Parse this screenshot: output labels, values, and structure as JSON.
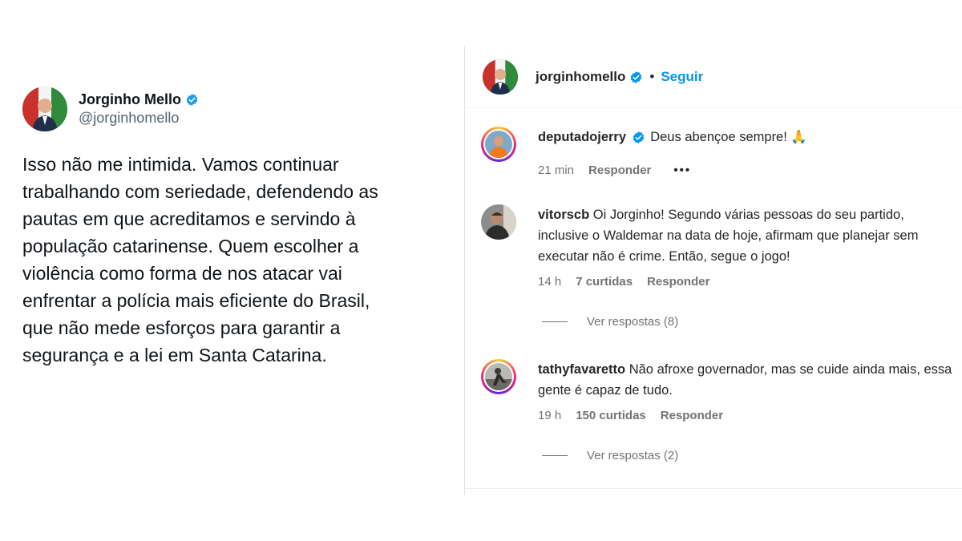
{
  "tweet": {
    "name": "Jorginho Mello",
    "handle": "@jorginhomello",
    "text": "Isso não me intimida. Vamos continuar\ntrabalhando com seriedade, defendendo as\npautas em que acreditamos e servindo à\npopulação catarinense. Quem escolher a\nviolência como forma de nos atacar vai\nenfrentar a polícia mais eficiente do Brasil,\nque não mede esforços para garantir a\nsegurança e a lei em Santa Catarina."
  },
  "instagram": {
    "username": "jorginhomello",
    "separator": "•",
    "follow_label": "Seguir",
    "comments": [
      {
        "user": "deputadojerry",
        "verified": true,
        "text": "Deus abençoe sempre! 🙏",
        "time": "21 min",
        "reply_label": "Responder",
        "more": "•••"
      },
      {
        "user": "vitorscb",
        "text": "Oi Jorginho! Segundo várias pessoas do seu partido, inclusive o Waldemar na data de hoje, afirmam que planejar sem executar não é crime. Então, segue o jogo!",
        "time": "14 h",
        "likes": "7 curtidas",
        "reply_label": "Responder",
        "view_replies": "Ver respostas (8)"
      },
      {
        "user": "tathyfavaretto",
        "text": "Não afroxe governador, mas se cuide ainda mais, essa gente é capaz de tudo.",
        "time": "19 h",
        "likes": "150 curtidas",
        "reply_label": "Responder",
        "view_replies": "Ver respostas (2)"
      }
    ]
  },
  "colors": {
    "verified_blue": "#1d9bf0",
    "follow_blue": "#0095f6",
    "secondary_text": "#737373"
  },
  "icons": [
    "verified-badge-icon",
    "more-options-icon"
  ]
}
